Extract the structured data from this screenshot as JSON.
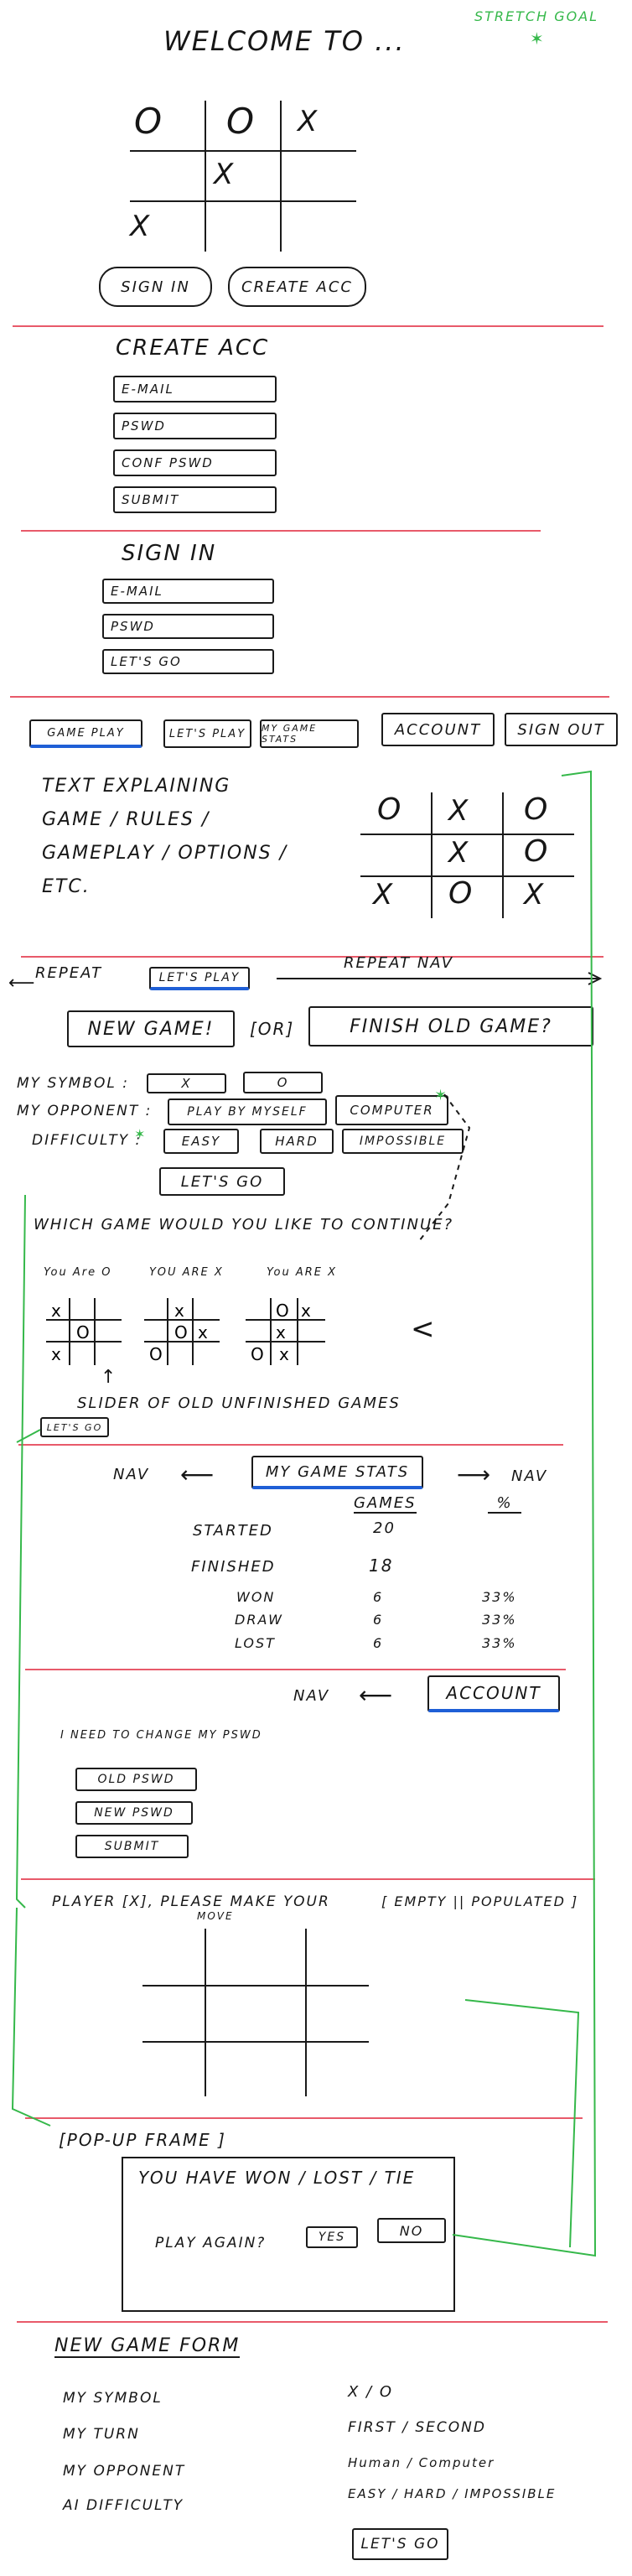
{
  "welcome": {
    "title": "WELCOME TO ...",
    "stretch_goal": "STRETCH GOAL",
    "board": [
      "O",
      "O",
      "X",
      "",
      "X",
      "",
      "X",
      "",
      ""
    ],
    "sign_in": "SIGN IN",
    "create_acc": "CREATE ACC"
  },
  "create_account": {
    "title": "CREATE ACC",
    "fields": [
      "E-MAIL",
      "PSWD",
      "CONF PSWD"
    ],
    "submit": "SUBMIT"
  },
  "sign_in": {
    "title": "SIGN IN",
    "fields": [
      "E-MAIL",
      "PSWD"
    ],
    "go": "LET'S GO"
  },
  "nav": {
    "tabs": [
      "GAME PLAY",
      "LET'S PLAY",
      "MY GAME STATS"
    ],
    "account": "ACCOUNT",
    "sign_out": "SIGN OUT"
  },
  "gameplay": {
    "explain": [
      "TEXT EXPLAINING",
      "GAME / RULES /",
      "GAMEPLAY / OPTIONS /",
      "ETC."
    ],
    "board": [
      "O",
      "X",
      "O",
      "",
      "X",
      "O",
      "X",
      "O",
      "X"
    ]
  },
  "lets_play": {
    "repeat": "REPEAT",
    "tab": "LET'S PLAY",
    "repeat_nav": "REPEAT NAV",
    "new_game": "NEW GAME!",
    "or": "[OR]",
    "finish_old": "FINISH OLD GAME?",
    "symbol_label": "MY SYMBOL :",
    "symbols": [
      "X",
      "O"
    ],
    "opponent_label": "MY OPPONENT :",
    "opponents": [
      "PLAY BY MYSELF",
      "COMPUTER"
    ],
    "difficulty_label": "DIFFICULTY :",
    "difficulties": [
      "EASY",
      "HARD",
      "IMPOSSIBLE"
    ],
    "go": "LET'S GO"
  },
  "continue": {
    "question": "WHICH GAME WOULD YOU LIKE TO CONTINUE?",
    "labels": [
      "You Are O",
      "YOU ARE X",
      "You ARE X"
    ],
    "slider": "SLIDER OF OLD UNFINISHED GAMES",
    "go": "LET'S GO"
  },
  "stats": {
    "nav_left": "NAV",
    "tab": "MY GAME STATS",
    "nav_right": "NAV",
    "col_games": "GAMES",
    "col_pct": "%",
    "rows": [
      {
        "label": "STARTED",
        "games": "20",
        "pct": ""
      },
      {
        "label": "FINISHED",
        "games": "18",
        "pct": ""
      },
      {
        "label": "WON",
        "games": "6",
        "pct": "33%"
      },
      {
        "label": "DRAW",
        "games": "6",
        "pct": "33%"
      },
      {
        "label": "LOST",
        "games": "6",
        "pct": "33%"
      }
    ]
  },
  "account": {
    "nav": "NAV",
    "tab": "ACCOUNT",
    "note": "I NEED TO CHANGE MY PSWD",
    "fields": [
      "OLD PSWD",
      "NEW PSWD"
    ],
    "submit": "SUBMIT"
  },
  "game": {
    "prompt": "PLAYER [X], PLEASE MAKE YOUR",
    "prompt_move": "MOVE",
    "state": "[ EMPTY || POPULATED ]"
  },
  "popup": {
    "title": "[POP-UP FRAME ]",
    "result": "YOU HAVE WON / LOST / TIE",
    "again": "PLAY AGAIN?",
    "yes": "YES",
    "no": "NO"
  },
  "new_game_form": {
    "title": "NEW GAME FORM",
    "rows": [
      {
        "label": "MY SYMBOL",
        "value": "X / O"
      },
      {
        "label": "MY TURN",
        "value": "FIRST / SECOND"
      },
      {
        "label": "MY OPPONENT",
        "value": "Human / Computer"
      },
      {
        "label": "AI DIFFICULTY",
        "value": "EASY / HARD / IMPOSSIBLE"
      }
    ],
    "go": "LET'S GO"
  },
  "colors": {
    "ink": "#161616",
    "divider": "#e85a6a",
    "accent_green": "#35b84a",
    "accent_blue": "#1f5fd6"
  }
}
